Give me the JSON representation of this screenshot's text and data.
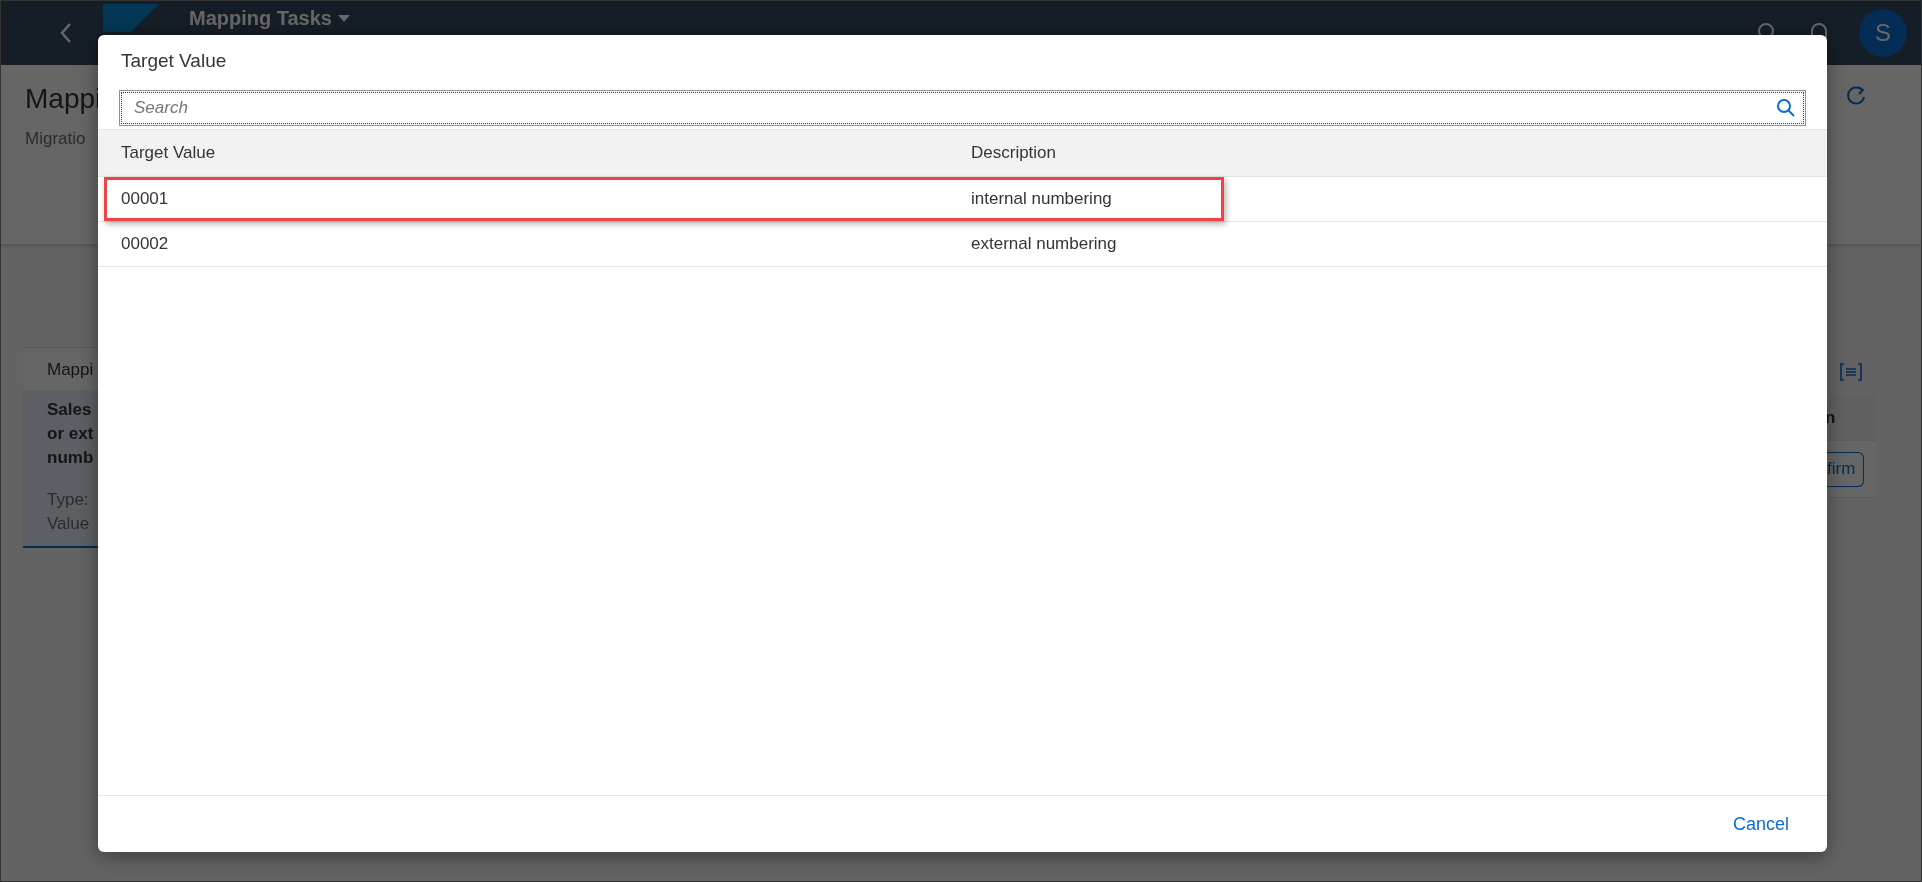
{
  "shell": {
    "title": "Mapping Tasks",
    "avatar": "S"
  },
  "page": {
    "title": "Mappi",
    "subtitle": "Migratio",
    "card_tab": "Mappi",
    "card_heading": [
      "Sales",
      "or ext",
      "numb"
    ],
    "fields": [
      "Type:",
      "Value"
    ],
    "right_header": "n",
    "right_button": "firm"
  },
  "dialog": {
    "title": "Target Value",
    "search": {
      "placeholder": "Search"
    },
    "columns": [
      "Target Value",
      "Description"
    ],
    "rows": [
      {
        "cells": [
          "00001",
          "internal numbering"
        ],
        "highlighted": true
      },
      {
        "cells": [
          "00002",
          "external numbering"
        ],
        "highlighted": false
      }
    ],
    "buttons": [
      "Cancel"
    ]
  }
}
